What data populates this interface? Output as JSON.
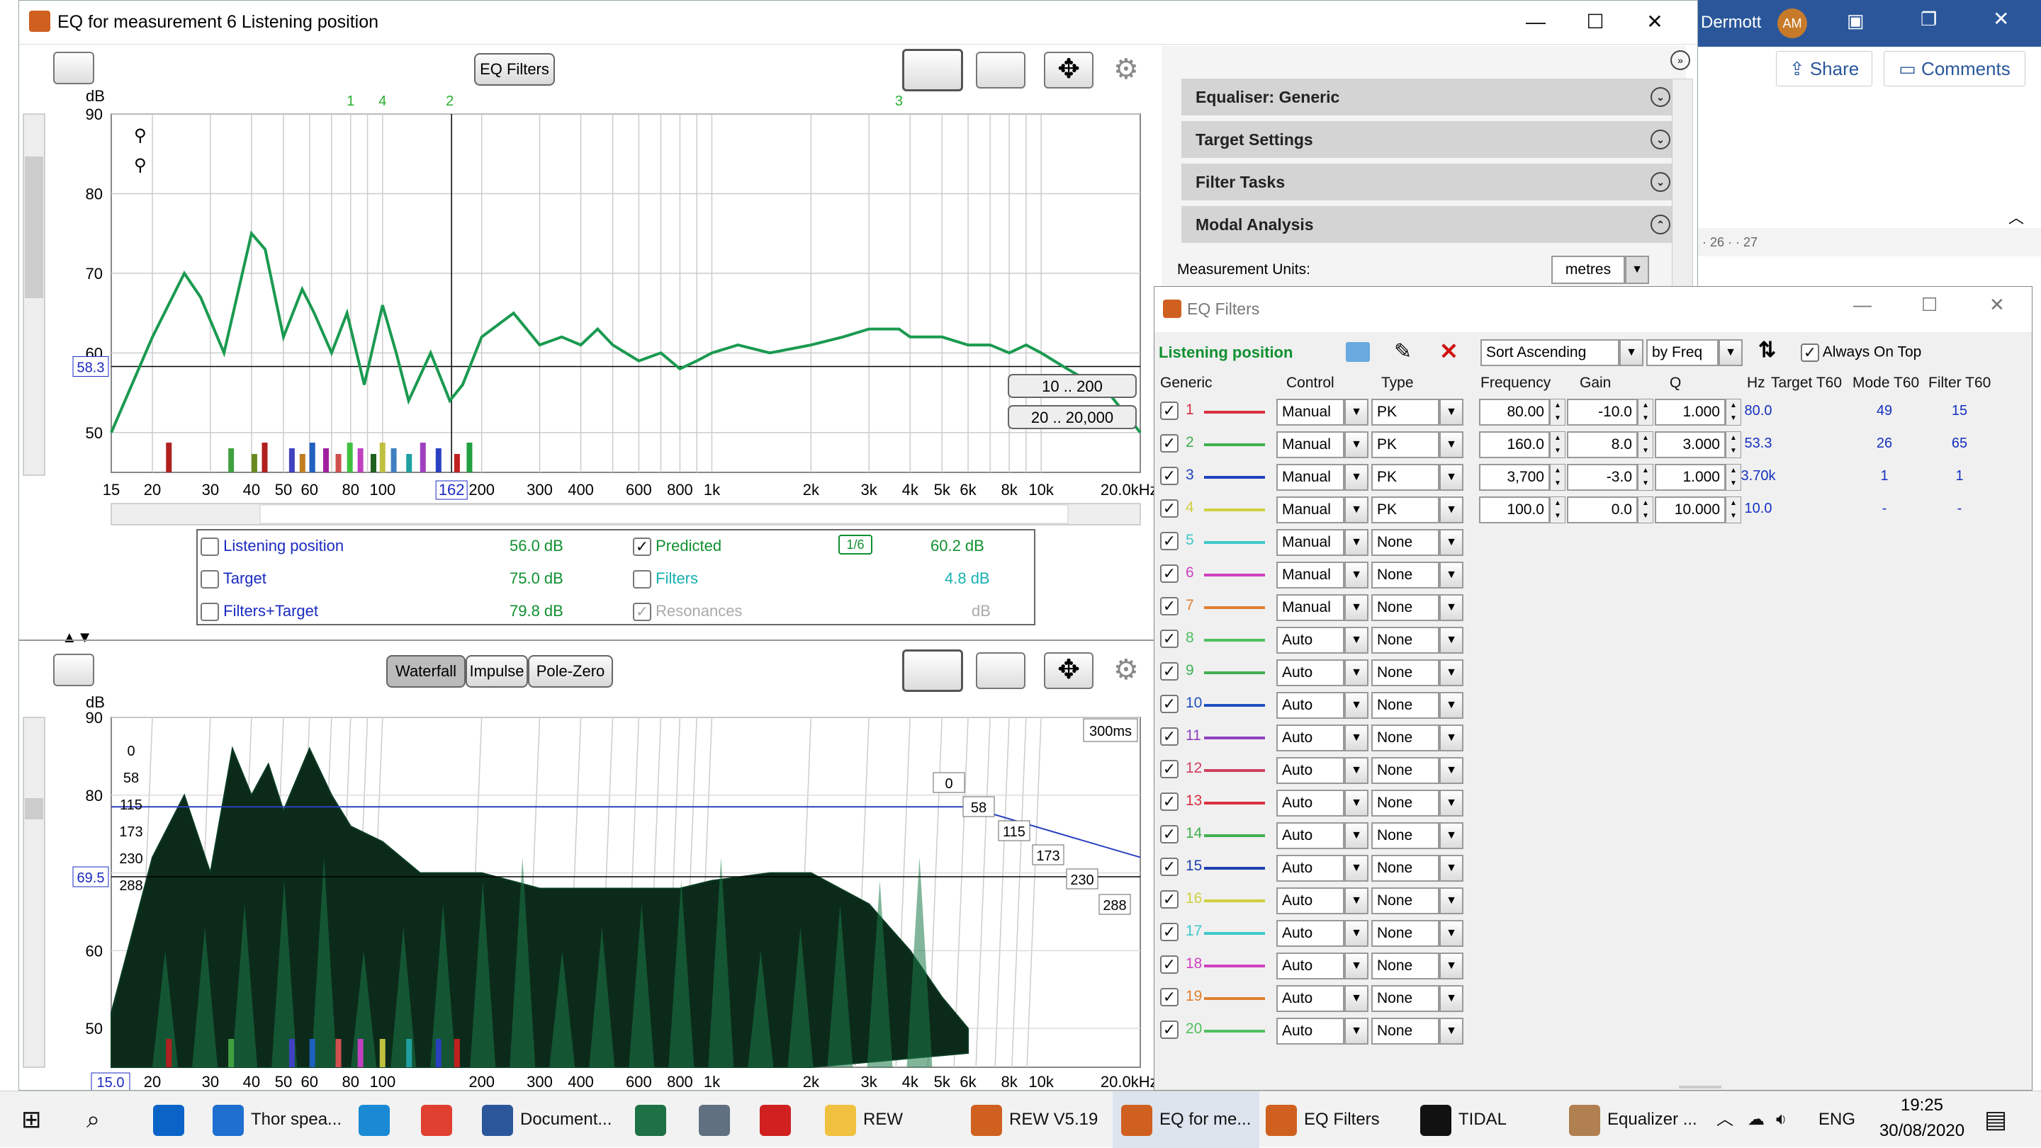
{
  "word": {
    "user": "Dermott",
    "avatar": "AM",
    "share": "Share",
    "comments": "Comments",
    "ruler": "· 26 · · 27"
  },
  "rew": {
    "title": "EQ for measurement 6 Listening position",
    "eq_filters_btn": "EQ Filters",
    "top_graph": {
      "ylabel": "dB",
      "yticks": [
        "90",
        "80",
        "70",
        "60",
        "50"
      ],
      "xticks": [
        "15",
        "20",
        "30",
        "40",
        "50",
        "60",
        "80",
        "100",
        "162",
        "200",
        "300",
        "400",
        "600",
        "800",
        "1k",
        "2k",
        "3k",
        "4k",
        "5k",
        "6k",
        "8k",
        "10k",
        "20.0kHz"
      ],
      "cursor_db": "58.3",
      "filter_markers": [
        "1",
        "4",
        "2",
        "3"
      ],
      "range_btn1": "10 .. 200",
      "range_btn2": "20 .. 20,000"
    },
    "legend": [
      {
        "name": "Listening position",
        "value": "56.0 dB",
        "checked": false,
        "color": "#1a2ac0"
      },
      {
        "name": "Target",
        "value": "75.0 dB",
        "checked": false,
        "color": "#1a2ac0"
      },
      {
        "name": "Filters+Target",
        "value": "79.8 dB",
        "checked": false,
        "color": "#1a2ac0"
      },
      {
        "name": "Predicted",
        "value": "60.2 dB",
        "checked": true,
        "color": "#109030",
        "smoothing": "1/6"
      },
      {
        "name": "Filters",
        "value": "4.8 dB",
        "checked": false,
        "color": "#18b0b0"
      },
      {
        "name": "Resonances",
        "value": "dB",
        "checked": true,
        "color": "#aaaaaa"
      }
    ],
    "bottom_tabs": [
      "Waterfall",
      "Impulse",
      "Pole-Zero"
    ],
    "bottom_graph": {
      "ylabel": "dB",
      "yticks": [
        "90",
        "80",
        "70",
        "60",
        "50"
      ],
      "cursor_db": "69.5",
      "start_freq": "15.0",
      "time_label": "300ms",
      "time_markers": [
        "0",
        "58",
        "115",
        "173",
        "230",
        "288"
      ],
      "xticks": [
        "20",
        "30",
        "40",
        "50",
        "60",
        "80",
        "100",
        "200",
        "300",
        "400",
        "600",
        "800",
        "1k",
        "2k",
        "3k",
        "4k",
        "5k",
        "6k",
        "8k",
        "10k",
        "20.0kHz"
      ]
    },
    "panels": [
      {
        "label": "Equaliser: Generic"
      },
      {
        "label": "Target Settings"
      },
      {
        "label": "Filter Tasks"
      },
      {
        "label": "Modal Analysis"
      }
    ],
    "measurement_units_label": "Measurement Units:",
    "measurement_units_value": "metres"
  },
  "eq": {
    "title": "EQ Filters",
    "measurement": "Listening position",
    "sort": "Sort Ascending",
    "sortby": "by Freq",
    "always_on_top": "Always On Top",
    "headers": [
      "Generic",
      "Control",
      "Type",
      "Frequency",
      "Gain",
      "Q",
      "Hz",
      "Target T60",
      "Mode T60",
      "Filter T60"
    ],
    "rows": [
      {
        "n": "1",
        "color": "#d83040",
        "control": "Manual",
        "type": "PK",
        "freq": "80.00",
        "gain": "-10.0",
        "q": "1.000",
        "hz": "80.0",
        "target": "",
        "mode": "49",
        "filter": "15"
      },
      {
        "n": "2",
        "color": "#40b050",
        "control": "Manual",
        "type": "PK",
        "freq": "160.0",
        "gain": "8.0",
        "q": "3.000",
        "hz": "53.3",
        "target": "",
        "mode": "26",
        "filter": "65"
      },
      {
        "n": "3",
        "color": "#2040c0",
        "control": "Manual",
        "type": "PK",
        "freq": "3,700",
        "gain": "-3.0",
        "q": "1.000",
        "hz": "3.70k",
        "target": "",
        "mode": "1",
        "filter": "1"
      },
      {
        "n": "4",
        "color": "#d0d040",
        "control": "Manual",
        "type": "PK",
        "freq": "100.0",
        "gain": "0.0",
        "q": "10.000",
        "hz": "10.0",
        "target": "",
        "mode": "-",
        "filter": "-"
      },
      {
        "n": "5",
        "color": "#40c8c8",
        "control": "Manual",
        "type": "None"
      },
      {
        "n": "6",
        "color": "#d040c0",
        "control": "Manual",
        "type": "None"
      },
      {
        "n": "7",
        "color": "#e08030",
        "control": "Manual",
        "type": "None"
      },
      {
        "n": "8",
        "color": "#50c060",
        "control": "Auto",
        "type": "None"
      },
      {
        "n": "9",
        "color": "#40b050",
        "control": "Auto",
        "type": "None"
      },
      {
        "n": "10",
        "color": "#2050c0",
        "control": "Auto",
        "type": "None"
      },
      {
        "n": "11",
        "color": "#9040c0",
        "control": "Auto",
        "type": "None"
      },
      {
        "n": "12",
        "color": "#d04060",
        "control": "Auto",
        "type": "None"
      },
      {
        "n": "13",
        "color": "#d83040",
        "control": "Auto",
        "type": "None"
      },
      {
        "n": "14",
        "color": "#40b050",
        "control": "Auto",
        "type": "None"
      },
      {
        "n": "15",
        "color": "#2040b0",
        "control": "Auto",
        "type": "None"
      },
      {
        "n": "16",
        "color": "#d0d040",
        "control": "Auto",
        "type": "None"
      },
      {
        "n": "17",
        "color": "#40c8c8",
        "control": "Auto",
        "type": "None"
      },
      {
        "n": "18",
        "color": "#d040c0",
        "control": "Auto",
        "type": "None"
      },
      {
        "n": "19",
        "color": "#e08030",
        "control": "Auto",
        "type": "None"
      },
      {
        "n": "20",
        "color": "#50c060",
        "control": "Auto",
        "type": "None"
      }
    ]
  },
  "taskbar": {
    "items": [
      {
        "label": "Thor spea...",
        "color": "#1f6fd0"
      },
      {
        "label": "",
        "color": "#1a8ad4"
      },
      {
        "label": "",
        "color": "#e04030"
      },
      {
        "label": "Document...",
        "color": "#2b579a"
      },
      {
        "label": "",
        "color": "#1e7145"
      },
      {
        "label": "",
        "color": "#607080"
      },
      {
        "label": "",
        "color": "#d02020"
      },
      {
        "label": "REW",
        "color": "#f0c040"
      },
      {
        "label": "REW V5.19",
        "color": "#d06020"
      },
      {
        "label": "EQ for me...",
        "color": "#d06020"
      },
      {
        "label": "EQ Filters",
        "color": "#d06020"
      },
      {
        "label": "TIDAL",
        "color": "#111111"
      },
      {
        "label": "Equalizer ...",
        "color": "#b08050"
      }
    ],
    "lang": "ENG",
    "time": "19:25",
    "date": "30/08/2020"
  }
}
